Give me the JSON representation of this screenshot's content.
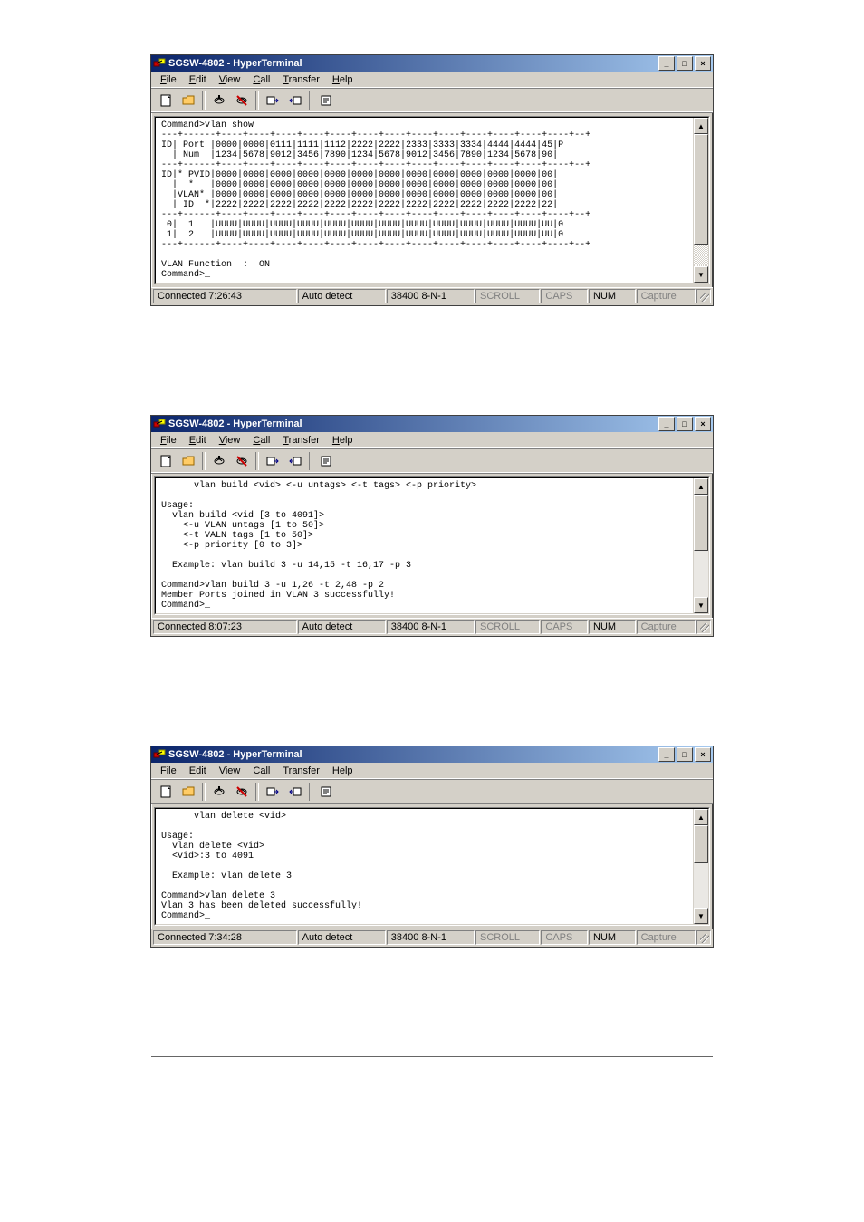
{
  "windows": [
    {
      "title": "SGSW-4802 - HyperTerminal",
      "status": {
        "conn": "Connected 7:26:43",
        "detect": "Auto detect",
        "port": "38400 8-N-1",
        "scroll": "SCROLL",
        "caps": "CAPS",
        "num": "NUM",
        "capture": "Capture"
      },
      "thumb_top": 0,
      "thumb_h": 120,
      "terminal": "Command>vlan show\n---+------+----+----+----+----+----+----+----+----+----+----+----+----+----+--+\nID| Port |0000|0000|0111|1111|1112|2222|2222|2333|3333|3334|4444|4444|45|P\n  | Num  |1234|5678|9012|3456|7890|1234|5678|9012|3456|7890|1234|5678|90|\n---+------+----+----+----+----+----+----+----+----+----+----+----+----+----+--+\nID|* PVID|0000|0000|0000|0000|0000|0000|0000|0000|0000|0000|0000|0000|00|\n  |  *   |0000|0000|0000|0000|0000|0000|0000|0000|0000|0000|0000|0000|00|\n  |VLAN* |0000|0000|0000|0000|0000|0000|0000|0000|0000|0000|0000|0000|00|\n  | ID  *|2222|2222|2222|2222|2222|2222|2222|2222|2222|2222|2222|2222|22|\n---+------+----+----+----+----+----+----+----+----+----+----+----+----+----+--+\n 0|  1   |UUUU|UUUU|UUUU|UUUU|UUUU|UUUU|UUUU|UUUU|UUUU|UUUU|UUUU|UUUU|UU|0\n 1|  2   |UUUU|UUUU|UUUU|UUUU|UUUU|UUUU|UUUU|UUUU|UUUU|UUUU|UUUU|UUUU|UU|0\n---+------+----+----+----+----+----+----+----+----+----+----+----+----+----+--+\n\nVLAN Function  :  ON\nCommand>_"
    },
    {
      "title": "SGSW-4802 - HyperTerminal",
      "status": {
        "conn": "Connected 8:07:23",
        "detect": "Auto detect",
        "port": "38400 8-N-1",
        "scroll": "SCROLL",
        "caps": "CAPS",
        "num": "NUM",
        "capture": "Capture"
      },
      "thumb_top": 0,
      "thumb_h": 60,
      "terminal": "      vlan build <vid> <-u untags> <-t tags> <-p priority>\n\nUsage:\n  vlan build <vid [3 to 4091]>\n    <-u VLAN untags [1 to 50]>\n    <-t VALN tags [1 to 50]>\n    <-p priority [0 to 3]>\n\n  Example: vlan build 3 -u 14,15 -t 16,17 -p 3\n\nCommand>vlan build 3 -u 1,26 -t 2,48 -p 2\nMember Ports joined in VLAN 3 successfully!\nCommand>_"
    },
    {
      "title": "SGSW-4802 - HyperTerminal",
      "status": {
        "conn": "Connected 7:34:28",
        "detect": "Auto detect",
        "port": "38400 8-N-1",
        "scroll": "SCROLL",
        "caps": "CAPS",
        "num": "NUM",
        "capture": "Capture"
      },
      "thumb_top": 0,
      "thumb_h": 40,
      "terminal": "      vlan delete <vid>\n\nUsage:\n  vlan delete <vid>\n  <vid>:3 to 4091\n\n  Example: vlan delete 3\n\nCommand>vlan delete 3\nVlan 3 has been deleted successfully!\nCommand>_"
    }
  ],
  "menu": [
    "File",
    "Edit",
    "View",
    "Call",
    "Transfer",
    "Help"
  ],
  "winbtn": {
    "min": "_",
    "max": "□",
    "close": "×"
  }
}
